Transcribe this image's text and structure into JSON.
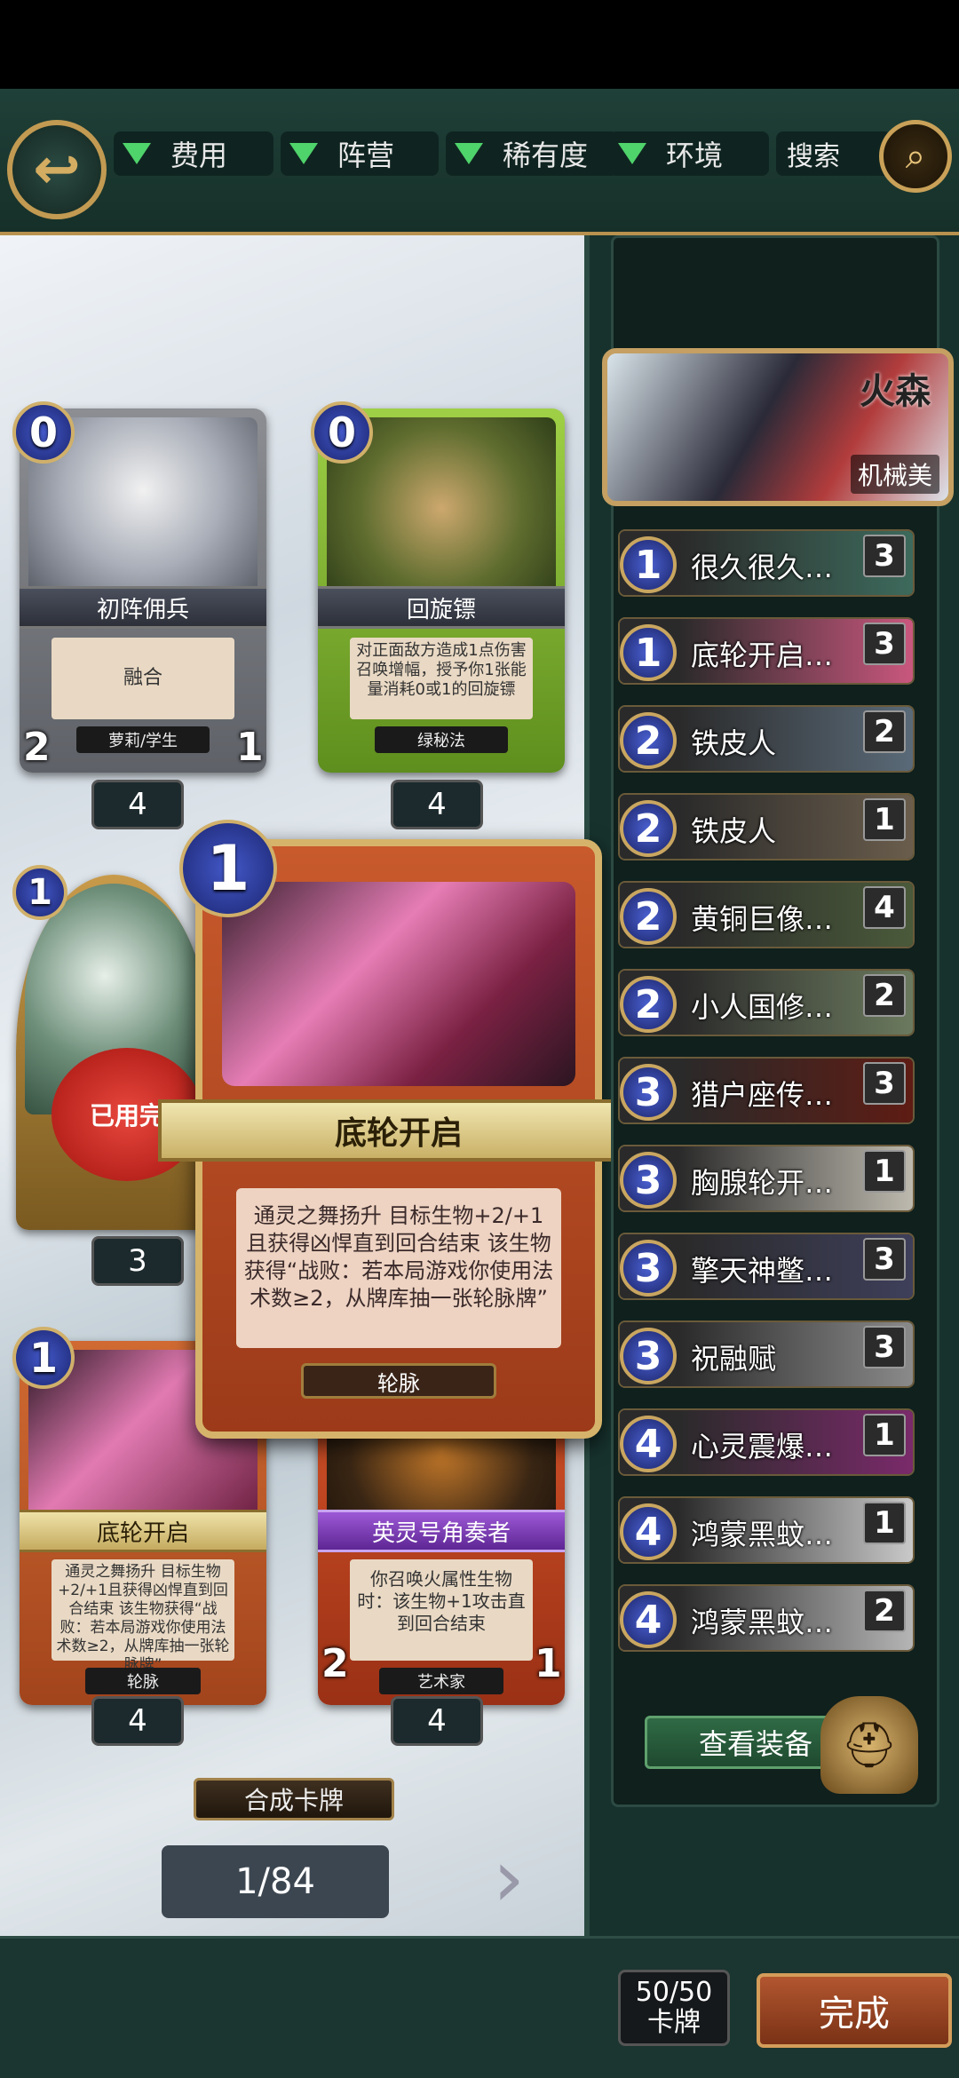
{
  "filters": {
    "cost": "费用",
    "faction": "阵营",
    "rarity": "稀有度",
    "environment": "环境",
    "search": "搜索"
  },
  "cards": [
    {
      "cost": "0",
      "name": "初阵佣兵",
      "desc": "融合",
      "tribe": "萝莉/学生",
      "attack": "2",
      "health": "1",
      "count": "4"
    },
    {
      "cost": "0",
      "name": "回旋镖",
      "desc": "对正面敌方造成1点伤害 召唤增幅，授予你1张能量消耗0或1的回旋镖",
      "tribe": "绿秘法",
      "count": "4"
    },
    {
      "cost": "1",
      "stamp": "已用完",
      "count": "3"
    },
    {
      "cost": "1",
      "name": "底轮开启",
      "desc": "通灵之舞扬升 目标生物+2/+1且获得凶悍直到回合结束 该生物获得“战败：若本局游戏你使用法术数≥2，从牌库抽一张轮脉牌”",
      "tribe": "轮脉",
      "count": "4"
    },
    {
      "name": "英灵号角奏者",
      "desc": "你召唤火属性生物时：该生物+1攻击直到回合结束",
      "tribe": "艺术家",
      "attack": "2",
      "health": "1",
      "count": "4"
    }
  ],
  "featured": {
    "cost": "1",
    "name": "底轮开启",
    "desc": "通灵之舞扬升 目标生物+2/+1且获得凶悍直到回合结束 该生物获得“战败：若本局游戏你使用法术数≥2，从牌库抽一张轮脉牌”",
    "tribe": "轮脉"
  },
  "synthesize_label": "合成卡牌",
  "page_indicator": "1/84",
  "hero": {
    "name": "火森",
    "class": "机械美"
  },
  "deck": [
    {
      "cost": "1",
      "name": "很久很久…",
      "count": "3",
      "color": "#3d6a5c"
    },
    {
      "cost": "1",
      "name": "底轮开启…",
      "count": "3",
      "color": "#c9577e"
    },
    {
      "cost": "2",
      "name": "铁皮人",
      "count": "2",
      "color": "#5a6a78"
    },
    {
      "cost": "2",
      "name": "铁皮人",
      "count": "1",
      "color": "#6a5d4c"
    },
    {
      "cost": "2",
      "name": "黄铜巨像…",
      "count": "4",
      "color": "#4a5a3a"
    },
    {
      "cost": "2",
      "name": "小人国修…",
      "count": "2",
      "color": "#6b7a5e"
    },
    {
      "cost": "3",
      "name": "猎户座传…",
      "count": "3",
      "color": "#5e1c14"
    },
    {
      "cost": "3",
      "name": "胸腺轮开…",
      "count": "1",
      "color": "#bdb9ae"
    },
    {
      "cost": "3",
      "name": "擎天神鳖…",
      "count": "3",
      "color": "#3e3f5a"
    },
    {
      "cost": "3",
      "name": "祝融赋",
      "count": "3",
      "color": "#8a8a8a"
    },
    {
      "cost": "4",
      "name": "心灵震爆…",
      "count": "1",
      "color": "#7a2a6a"
    },
    {
      "cost": "4",
      "name": "鸿蒙黑蚊…",
      "count": "1",
      "color": "#c9c9c9"
    },
    {
      "cost": "4",
      "name": "鸿蒙黑蚊…",
      "count": "2",
      "color": "#b5b5b5"
    }
  ],
  "equip_label": "查看装备",
  "deck_count": {
    "value": "50/50",
    "unit": "卡牌"
  },
  "done_label": "完成"
}
